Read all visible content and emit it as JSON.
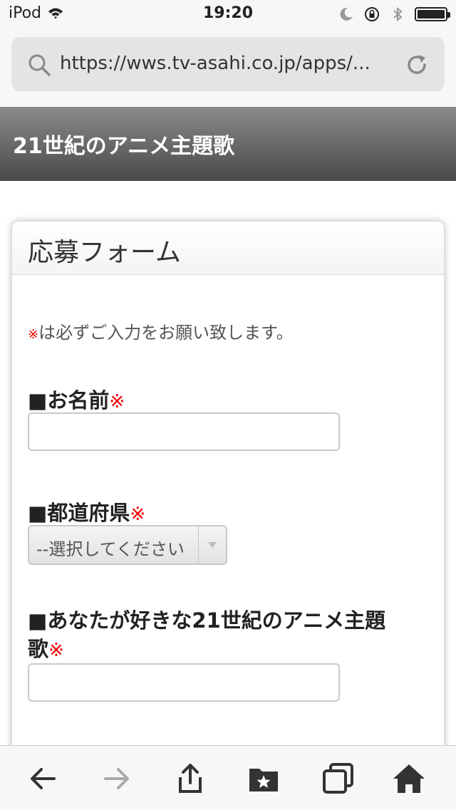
{
  "status_bar": {
    "carrier": "iPod",
    "time": "19:20",
    "icons": [
      "wifi-icon",
      "moon-icon",
      "rotation-lock-icon",
      "bluetooth-icon",
      "battery-icon"
    ],
    "battery_level": 1.0
  },
  "browser": {
    "url": "https://wws.tv-asahi.co.jp/apps/...",
    "search_icon": "search-icon",
    "reload_icon": "reload-icon"
  },
  "site": {
    "title": "21世紀のアニメ主題歌"
  },
  "form": {
    "title": "応募フォーム",
    "required_mark": "※",
    "note_text": "は必ずご入力をお願い致します。",
    "fields": [
      {
        "label": "■お名前",
        "required": "※",
        "type": "text",
        "value": ""
      },
      {
        "label": "■都道府県",
        "required": "※",
        "type": "select",
        "selected": "--選択してください"
      },
      {
        "label_line1": "■あなたが好きな21世紀のアニメ主題",
        "label_line2": "歌",
        "required": "※",
        "type": "text",
        "value": ""
      }
    ]
  },
  "toolbar": {
    "buttons": [
      "back-icon",
      "forward-icon",
      "share-icon",
      "bookmarks-icon",
      "tabs-icon",
      "home-icon"
    ]
  },
  "colors": {
    "required": "#ee0000",
    "header_top": "#8a8a8a",
    "header_bottom": "#4a4a4a",
    "accent_gray": "#e4e4e4"
  }
}
